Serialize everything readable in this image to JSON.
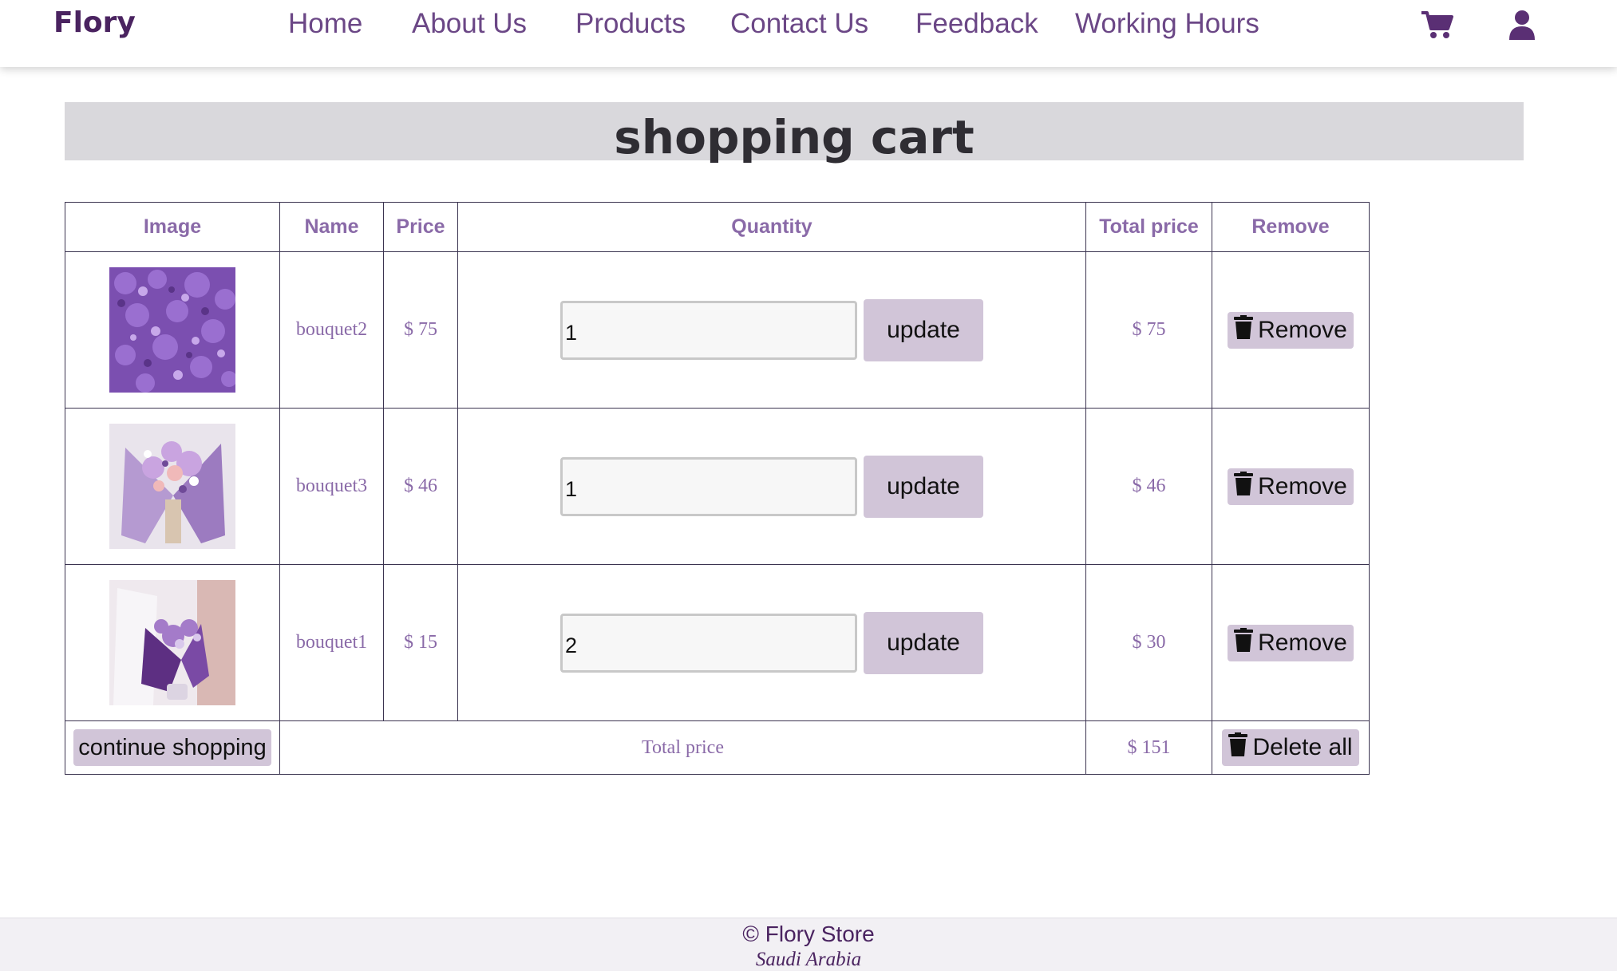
{
  "header": {
    "brand": "Flory",
    "nav": [
      "Home",
      "About Us",
      "Products",
      "Contact Us",
      "Feedback",
      "Working Hours"
    ],
    "icons": {
      "cart": "cart-icon",
      "user": "user-icon"
    }
  },
  "page": {
    "title": "shopping cart"
  },
  "table": {
    "headers": {
      "image": "Image",
      "name": "Name",
      "price": "Price",
      "quantity": "Quantity",
      "total": "Total price",
      "remove": "Remove"
    },
    "rows": [
      {
        "name": "bouquet2",
        "price": "$ 75",
        "quantity": "1",
        "total": "$ 75",
        "update_label": "update",
        "remove_label": "Remove"
      },
      {
        "name": "bouquet3",
        "price": "$ 46",
        "quantity": "1",
        "total": "$ 46",
        "update_label": "update",
        "remove_label": "Remove"
      },
      {
        "name": "bouquet1",
        "price": "$ 15",
        "quantity": "2",
        "total": "$ 30",
        "update_label": "update",
        "remove_label": "Remove"
      }
    ],
    "footer": {
      "continue_label": "continue shopping",
      "total_label": "Total price",
      "total_value": "$ 151",
      "delete_all_label": "Delete all"
    }
  },
  "site_footer": {
    "copyright": "© Flory Store",
    "location": "Saudi Arabia"
  },
  "colors": {
    "brand": "#4a2360",
    "nav": "#6b4786",
    "table_text": "#8a6aa8",
    "button_bg": "#d1c5d8",
    "title_band": "#d9d8dc"
  }
}
